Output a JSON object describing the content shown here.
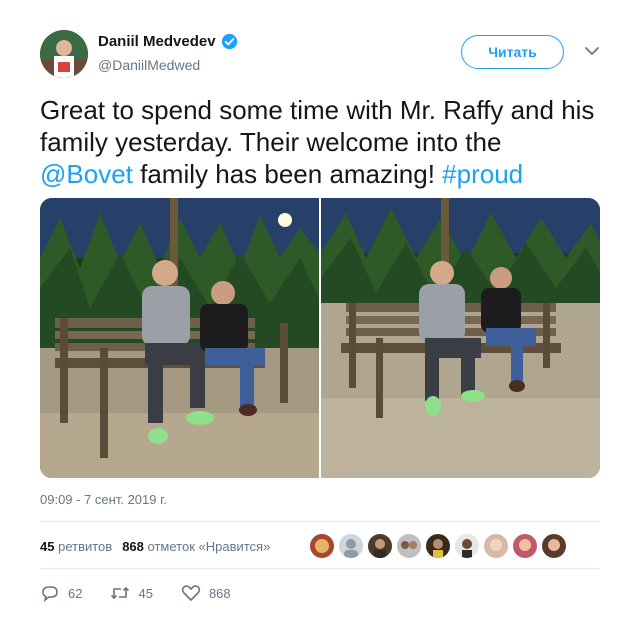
{
  "author": {
    "display_name": "Daniil Medvedev",
    "handle": "@DaniilMedwed",
    "verified": true
  },
  "follow_button": {
    "label": "Читать"
  },
  "tweet": {
    "line_parts": [
      "Great to spend some time with Mr. Raffy and his family yesterday. Their welcome into the ",
      "@Bovet",
      " family has been amazing! ",
      "#proud"
    ]
  },
  "timestamp": "09:09 - 7 сент. 2019 г.",
  "stats": {
    "retweets_count": "45",
    "retweets_label": "ретвитов",
    "likes_count": "868",
    "likes_label": "отметок «Нравится»"
  },
  "actions": {
    "reply_count": "62",
    "retweet_count": "45",
    "like_count": "868"
  },
  "colors": {
    "accent": "#1da1f2",
    "text": "#14171a",
    "muted": "#657786"
  }
}
